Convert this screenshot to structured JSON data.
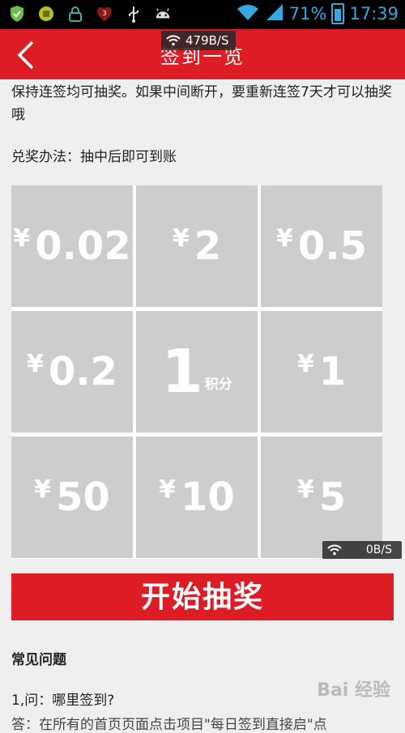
{
  "status_bar": {
    "battery_percent": "71%",
    "time": "17:39",
    "icons": [
      "shield-icon",
      "puzzle-icon",
      "lock-icon",
      "badge-icon",
      "usb-icon",
      "android-icon",
      "wifi-icon",
      "signal-icon",
      "battery-icon"
    ],
    "badge_count": "3"
  },
  "header": {
    "title": "签到一览",
    "speed_overlay": "479B/S",
    "colors": {
      "brand": "#dd1c25"
    }
  },
  "content": {
    "rule_text": "保持连签均可抽奖。如果中间断开，要重新连签7天才可以抽奖哦",
    "redeem_text": "兑奖办法：抽中后即可到账"
  },
  "prizes": {
    "currency": "¥",
    "cells": [
      {
        "value": "0.02"
      },
      {
        "value": "2"
      },
      {
        "value": "0.5"
      },
      {
        "value": "0.2"
      },
      {
        "value": "1",
        "unit": "积分"
      },
      {
        "value": "1"
      },
      {
        "value": "50"
      },
      {
        "value": "10"
      },
      {
        "value": "5"
      }
    ]
  },
  "speed_overlay_bottom": "0B/S",
  "actions": {
    "start_draw": "开始抽奖"
  },
  "faq": {
    "title": "常见问题",
    "q1": "1,问：哪里签到?",
    "a1": "答：在所有的首页页面点击项目\"每日签到直接启\"点"
  },
  "watermark": "Bai 经验"
}
